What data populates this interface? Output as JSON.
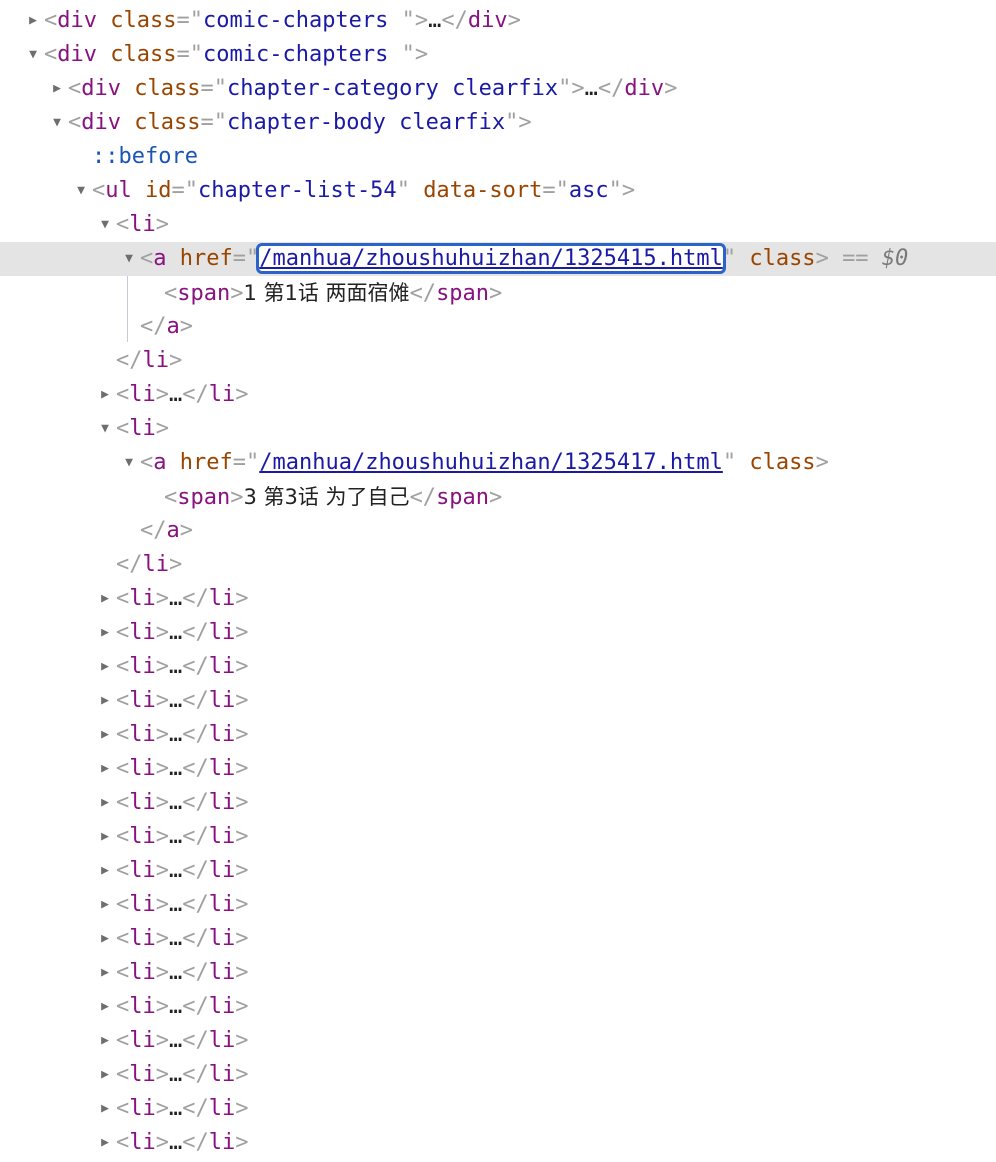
{
  "rows": [
    {
      "indent": 1,
      "tri": "▶",
      "kind": "collapsed",
      "tag": "div",
      "attr": "class",
      "val": "comic-chapters "
    },
    {
      "indent": 1,
      "tri": "▼",
      "kind": "open",
      "tag": "div",
      "attr": "class",
      "val": "comic-chapters "
    },
    {
      "indent": 2,
      "tri": "▶",
      "kind": "collapsed",
      "tag": "div",
      "attr": "class",
      "val": "chapter-category clearfix"
    },
    {
      "indent": 2,
      "tri": "▼",
      "kind": "open",
      "tag": "div",
      "attr": "class",
      "val": "chapter-body clearfix"
    },
    {
      "indent": 3,
      "tri": "",
      "kind": "pseudo",
      "text": "::before"
    },
    {
      "indent": 3,
      "tri": "▼",
      "kind": "ul",
      "tag": "ul",
      "attr1": "id",
      "val1": "chapter-list-54",
      "attr2": "data-sort",
      "val2": "asc"
    },
    {
      "indent": 4,
      "tri": "▼",
      "kind": "open-li",
      "tag": "li"
    },
    {
      "indent": 5,
      "tri": "▼",
      "kind": "anchor-selected",
      "tag": "a",
      "attr": "href",
      "href": "/manhua/zhoushuhuizhan/1325415.html",
      "attr2": "class",
      "eq": "==",
      "dollar": "$0"
    },
    {
      "indent": 6,
      "tri": "",
      "kind": "span",
      "tag": "span",
      "text": "1 第1话 两面宿傩"
    },
    {
      "indent": 5,
      "tri": "",
      "kind": "close",
      "tag": "a"
    },
    {
      "indent": 4,
      "tri": "",
      "kind": "close",
      "tag": "li"
    },
    {
      "indent": 4,
      "tri": "▶",
      "kind": "collapsed-li",
      "tag": "li"
    },
    {
      "indent": 4,
      "tri": "▼",
      "kind": "open-li",
      "tag": "li"
    },
    {
      "indent": 5,
      "tri": "▼",
      "kind": "anchor",
      "tag": "a",
      "attr": "href",
      "href": "/manhua/zhoushuhuizhan/1325417.html",
      "attr2": "class"
    },
    {
      "indent": 6,
      "tri": "",
      "kind": "span",
      "tag": "span",
      "text": "3 第3话 为了自己"
    },
    {
      "indent": 5,
      "tri": "",
      "kind": "close",
      "tag": "a"
    },
    {
      "indent": 4,
      "tri": "",
      "kind": "close",
      "tag": "li"
    },
    {
      "indent": 4,
      "tri": "▶",
      "kind": "collapsed-li",
      "tag": "li"
    },
    {
      "indent": 4,
      "tri": "▶",
      "kind": "collapsed-li",
      "tag": "li"
    },
    {
      "indent": 4,
      "tri": "▶",
      "kind": "collapsed-li",
      "tag": "li"
    },
    {
      "indent": 4,
      "tri": "▶",
      "kind": "collapsed-li",
      "tag": "li"
    },
    {
      "indent": 4,
      "tri": "▶",
      "kind": "collapsed-li",
      "tag": "li"
    },
    {
      "indent": 4,
      "tri": "▶",
      "kind": "collapsed-li",
      "tag": "li"
    },
    {
      "indent": 4,
      "tri": "▶",
      "kind": "collapsed-li",
      "tag": "li"
    },
    {
      "indent": 4,
      "tri": "▶",
      "kind": "collapsed-li",
      "tag": "li"
    },
    {
      "indent": 4,
      "tri": "▶",
      "kind": "collapsed-li",
      "tag": "li"
    },
    {
      "indent": 4,
      "tri": "▶",
      "kind": "collapsed-li",
      "tag": "li"
    },
    {
      "indent": 4,
      "tri": "▶",
      "kind": "collapsed-li",
      "tag": "li"
    },
    {
      "indent": 4,
      "tri": "▶",
      "kind": "collapsed-li",
      "tag": "li"
    },
    {
      "indent": 4,
      "tri": "▶",
      "kind": "collapsed-li",
      "tag": "li"
    },
    {
      "indent": 4,
      "tri": "▶",
      "kind": "collapsed-li",
      "tag": "li"
    },
    {
      "indent": 4,
      "tri": "▶",
      "kind": "collapsed-li",
      "tag": "li"
    },
    {
      "indent": 4,
      "tri": "▶",
      "kind": "collapsed-li",
      "tag": "li"
    },
    {
      "indent": 4,
      "tri": "▶",
      "kind": "collapsed-li",
      "tag": "li"
    }
  ],
  "glyphs": {
    "ellipsis": "…"
  },
  "colors": {
    "tag": "#881280",
    "attribute": "#994500",
    "value": "#1a1aa6",
    "selection": "#e4e4e4",
    "edit_outline": "#2c63c9"
  }
}
